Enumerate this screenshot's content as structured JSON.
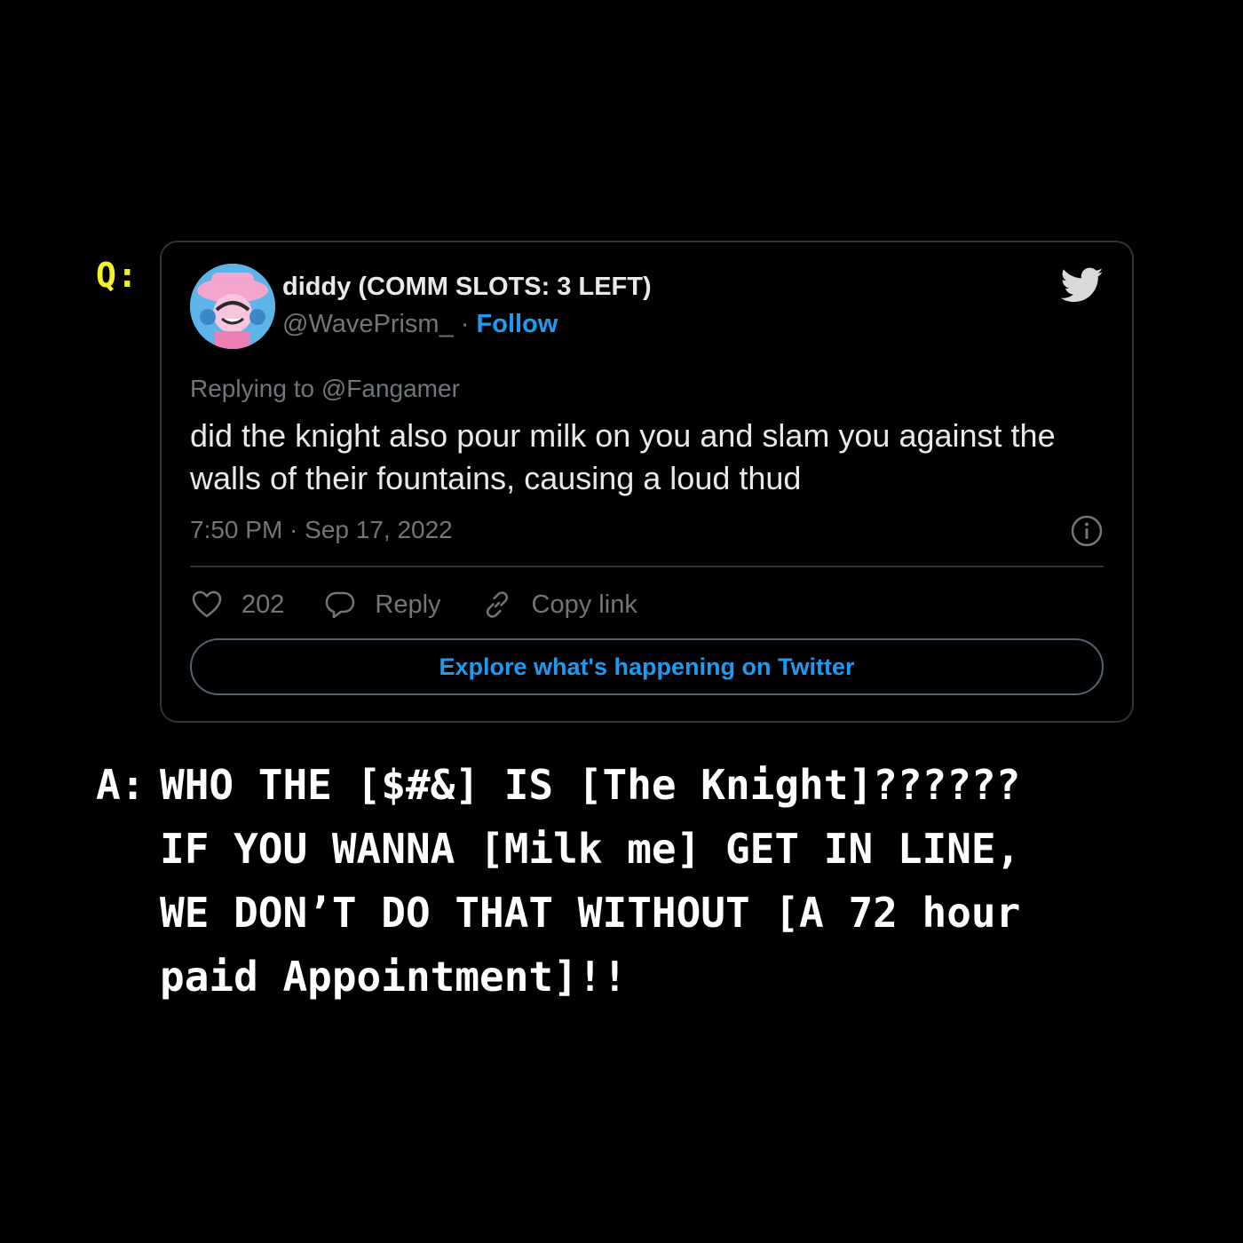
{
  "question_label": "Q:",
  "tweet": {
    "author_name": "diddy (COMM SLOTS: 3 LEFT)",
    "handle": "@WavePrism_",
    "separator": " · ",
    "follow_label": "Follow",
    "replying_to": "Replying to @Fangamer",
    "text": "did the knight also pour milk on you and slam you against the walls of their fountains, causing a loud thud",
    "timestamp": "7:50 PM · Sep 17, 2022",
    "likes_count": "202",
    "reply_label": "Reply",
    "copy_link_label": "Copy link",
    "explore_label": "Explore what's happening on Twitter",
    "accent_color": "#1d9bf0",
    "icons": [
      "twitter-bird-icon",
      "info-icon",
      "heart-icon",
      "reply-bubble-icon",
      "link-icon"
    ]
  },
  "answer": {
    "prefix": "A:",
    "lines": [
      "WHO THE [$#&] IS [The Knight]??????",
      "IF YOU WANNA [Milk me] GET IN LINE,",
      "WE DON’T DO THAT WITHOUT [A 72 hour",
      "paid Appointment]!!"
    ]
  },
  "colors": {
    "background": "#000000",
    "question_label": "#f2f227",
    "answer_text": "#ffffff",
    "card_border": "#2f3336",
    "muted_text": "#71767b"
  }
}
